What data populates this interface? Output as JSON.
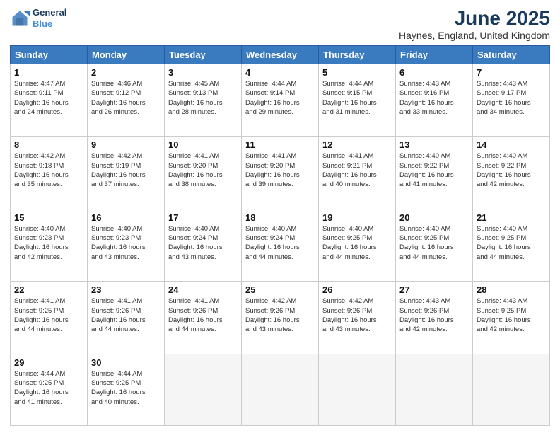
{
  "header": {
    "logo_line1": "General",
    "logo_line2": "Blue",
    "title": "June 2025",
    "subtitle": "Haynes, England, United Kingdom"
  },
  "days_of_week": [
    "Sunday",
    "Monday",
    "Tuesday",
    "Wednesday",
    "Thursday",
    "Friday",
    "Saturday"
  ],
  "weeks": [
    [
      {
        "day": "1",
        "info": "Sunrise: 4:47 AM\nSunset: 9:11 PM\nDaylight: 16 hours\nand 24 minutes."
      },
      {
        "day": "2",
        "info": "Sunrise: 4:46 AM\nSunset: 9:12 PM\nDaylight: 16 hours\nand 26 minutes."
      },
      {
        "day": "3",
        "info": "Sunrise: 4:45 AM\nSunset: 9:13 PM\nDaylight: 16 hours\nand 28 minutes."
      },
      {
        "day": "4",
        "info": "Sunrise: 4:44 AM\nSunset: 9:14 PM\nDaylight: 16 hours\nand 29 minutes."
      },
      {
        "day": "5",
        "info": "Sunrise: 4:44 AM\nSunset: 9:15 PM\nDaylight: 16 hours\nand 31 minutes."
      },
      {
        "day": "6",
        "info": "Sunrise: 4:43 AM\nSunset: 9:16 PM\nDaylight: 16 hours\nand 33 minutes."
      },
      {
        "day": "7",
        "info": "Sunrise: 4:43 AM\nSunset: 9:17 PM\nDaylight: 16 hours\nand 34 minutes."
      }
    ],
    [
      {
        "day": "8",
        "info": "Sunrise: 4:42 AM\nSunset: 9:18 PM\nDaylight: 16 hours\nand 35 minutes."
      },
      {
        "day": "9",
        "info": "Sunrise: 4:42 AM\nSunset: 9:19 PM\nDaylight: 16 hours\nand 37 minutes."
      },
      {
        "day": "10",
        "info": "Sunrise: 4:41 AM\nSunset: 9:20 PM\nDaylight: 16 hours\nand 38 minutes."
      },
      {
        "day": "11",
        "info": "Sunrise: 4:41 AM\nSunset: 9:20 PM\nDaylight: 16 hours\nand 39 minutes."
      },
      {
        "day": "12",
        "info": "Sunrise: 4:41 AM\nSunset: 9:21 PM\nDaylight: 16 hours\nand 40 minutes."
      },
      {
        "day": "13",
        "info": "Sunrise: 4:40 AM\nSunset: 9:22 PM\nDaylight: 16 hours\nand 41 minutes."
      },
      {
        "day": "14",
        "info": "Sunrise: 4:40 AM\nSunset: 9:22 PM\nDaylight: 16 hours\nand 42 minutes."
      }
    ],
    [
      {
        "day": "15",
        "info": "Sunrise: 4:40 AM\nSunset: 9:23 PM\nDaylight: 16 hours\nand 42 minutes."
      },
      {
        "day": "16",
        "info": "Sunrise: 4:40 AM\nSunset: 9:23 PM\nDaylight: 16 hours\nand 43 minutes."
      },
      {
        "day": "17",
        "info": "Sunrise: 4:40 AM\nSunset: 9:24 PM\nDaylight: 16 hours\nand 43 minutes."
      },
      {
        "day": "18",
        "info": "Sunrise: 4:40 AM\nSunset: 9:24 PM\nDaylight: 16 hours\nand 44 minutes."
      },
      {
        "day": "19",
        "info": "Sunrise: 4:40 AM\nSunset: 9:25 PM\nDaylight: 16 hours\nand 44 minutes."
      },
      {
        "day": "20",
        "info": "Sunrise: 4:40 AM\nSunset: 9:25 PM\nDaylight: 16 hours\nand 44 minutes."
      },
      {
        "day": "21",
        "info": "Sunrise: 4:40 AM\nSunset: 9:25 PM\nDaylight: 16 hours\nand 44 minutes."
      }
    ],
    [
      {
        "day": "22",
        "info": "Sunrise: 4:41 AM\nSunset: 9:25 PM\nDaylight: 16 hours\nand 44 minutes."
      },
      {
        "day": "23",
        "info": "Sunrise: 4:41 AM\nSunset: 9:26 PM\nDaylight: 16 hours\nand 44 minutes."
      },
      {
        "day": "24",
        "info": "Sunrise: 4:41 AM\nSunset: 9:26 PM\nDaylight: 16 hours\nand 44 minutes."
      },
      {
        "day": "25",
        "info": "Sunrise: 4:42 AM\nSunset: 9:26 PM\nDaylight: 16 hours\nand 43 minutes."
      },
      {
        "day": "26",
        "info": "Sunrise: 4:42 AM\nSunset: 9:26 PM\nDaylight: 16 hours\nand 43 minutes."
      },
      {
        "day": "27",
        "info": "Sunrise: 4:43 AM\nSunset: 9:26 PM\nDaylight: 16 hours\nand 42 minutes."
      },
      {
        "day": "28",
        "info": "Sunrise: 4:43 AM\nSunset: 9:25 PM\nDaylight: 16 hours\nand 42 minutes."
      }
    ],
    [
      {
        "day": "29",
        "info": "Sunrise: 4:44 AM\nSunset: 9:25 PM\nDaylight: 16 hours\nand 41 minutes."
      },
      {
        "day": "30",
        "info": "Sunrise: 4:44 AM\nSunset: 9:25 PM\nDaylight: 16 hours\nand 40 minutes."
      },
      null,
      null,
      null,
      null,
      null
    ]
  ]
}
